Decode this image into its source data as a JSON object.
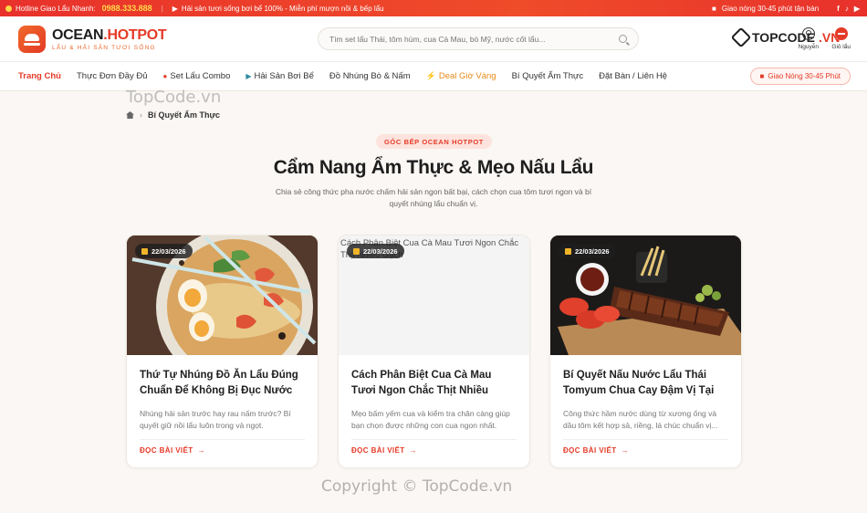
{
  "topbar": {
    "hotline_label": "Hotline Giao Lẩu Nhanh:",
    "hotline_number": "0988.333.888",
    "promo": "Hải sản tươi sống bơi bể 100% - Miễn phí mượn nồi & bếp lẩu",
    "delivery": "Giao nóng 30-45 phút tận bàn"
  },
  "header": {
    "logo_main": "OCEAN",
    "logo_accent": ".HOTPOT",
    "logo_sub": "LẨU & HẢI SẢN TƯƠI SỐNG",
    "search_placeholder": "Tìm set lẩu Thái, tôm hùm, cua Cà Mau, bò Mỹ, nước cốt lẩu...",
    "user_label": "Nguyễn",
    "cart_label": "Giỏ lẩu",
    "watermark_logo_1": "TOPCODE",
    "watermark_logo_2": ".VN"
  },
  "nav": {
    "items": [
      {
        "label": "Trang Chủ"
      },
      {
        "label": "Thực Đơn Đầy Đủ"
      },
      {
        "label": "Set Lẩu Combo"
      },
      {
        "label": "Hải Sản Bơi Bể"
      },
      {
        "label": "Đồ Nhúng Bò & Nấm"
      },
      {
        "label": "Deal Giờ Vàng"
      },
      {
        "label": "Bí Quyết Ẩm Thực"
      },
      {
        "label": "Đặt Bàn / Liên Hệ"
      }
    ],
    "cta": "Giao Nóng 30-45 Phút"
  },
  "watermarks": {
    "nav_area": "TopCode.vn",
    "footer": "Copyright © TopCode.vn"
  },
  "breadcrumb": {
    "current": "Bí Quyết Ẩm Thực"
  },
  "section": {
    "tag": "GÓC BẾP OCEAN HOTPOT",
    "title": "Cẩm Nang Ẩm Thực & Mẹo Nấu Lẩu",
    "description": "Chia sẻ công thức pha nước chấm hải sản ngon bất bại, cách chọn cua tôm tươi ngon và bí quyết nhúng lẩu chuẩn vị."
  },
  "cards": [
    {
      "date": "22/03/2026",
      "title": "Thứ Tự Nhúng Đồ Ăn Lẩu Đúng Chuẩn Để Không Bị Đục Nước",
      "excerpt": "Nhúng hải sản trước hay rau nấm trước? Bí quyết giữ nồi lẩu luôn trong và ngọt.",
      "read_more": "ĐỌC BÀI VIẾT"
    },
    {
      "date": "22/03/2026",
      "image_alt": "Cách Phân Biệt Cua Cà Mau Tươi Ngon Chắc Thịt Nhiều Gạch",
      "title": "Cách Phân Biệt Cua Cà Mau Tươi Ngon Chắc Thịt Nhiều Gạch",
      "excerpt": "Mẹo bấm yếm cua và kiểm tra chân càng giúp bạn chọn được những con cua ngon nhất.",
      "read_more": "ĐỌC BÀI VIẾT"
    },
    {
      "date": "22/03/2026",
      "title": "Bí Quyết Nấu Nước Lẩu Thái Tomyum Chua Cay Đậm Vị Tại Nhà",
      "excerpt": "Công thức hầm nước dùng từ xương ống và dầu tôm kết hợp sả, riềng, lá chúc chuẩn vị...",
      "read_more": "ĐỌC BÀI VIẾT"
    }
  ]
}
